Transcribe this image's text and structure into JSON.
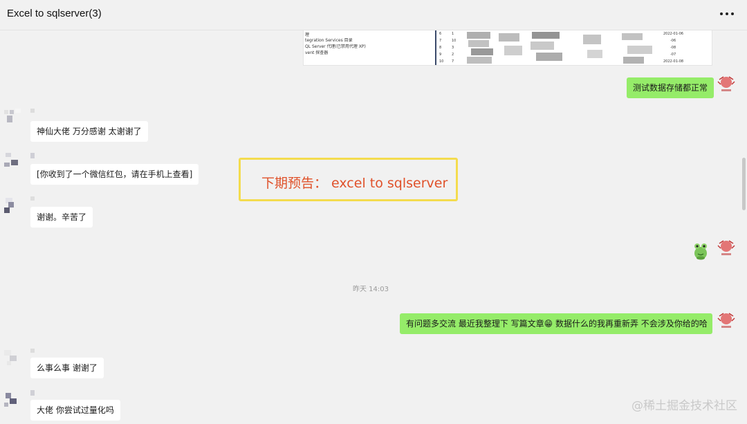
{
  "window": {
    "title": "Excel to sqlserver(3)",
    "more_icon": "more-horizontal-icon"
  },
  "embedded_screenshot": {
    "tree_items": [
      "理",
      "tegration Services 目录",
      "QL Server 代理(已禁用代理 XP)",
      "vent 探查器"
    ],
    "row_numbers": [
      "6",
      "7",
      "8",
      "9",
      "10"
    ],
    "row_values": [
      "1",
      "10",
      "3",
      "2",
      "7"
    ],
    "date_fragments": [
      "2022-01-06",
      "-06",
      "-08",
      "-07",
      "2022-01-08"
    ]
  },
  "messages": [
    {
      "side": "me",
      "text": "测试数据存储都正常"
    },
    {
      "side": "them",
      "text": "神仙大佬 万分感谢 太谢谢了"
    },
    {
      "side": "them",
      "text": "[你收到了一个微信红包，请在手机上查看]"
    },
    {
      "side": "them",
      "text": "谢谢。辛苦了"
    },
    {
      "side": "me",
      "sticker": "frog-sticker-icon"
    },
    {
      "side": "me",
      "text": "有问题多交流 最近我整理下 写篇文章😁 数据什么的我再重新弄 不会涉及你给的哈"
    },
    {
      "side": "them",
      "text": "么事么事 谢谢了"
    },
    {
      "side": "them",
      "text": "大佬 你尝试过量化吗"
    }
  ],
  "timestamp": "昨天 14:03",
  "announcement": "下期预告：  excel to sqlserver",
  "watermark": "@稀土掘金技术社区",
  "colors": {
    "background": "#f1f1f1",
    "bubble_me": "#95ec69",
    "bubble_them": "#ffffff",
    "announce_border": "#f4dc4e",
    "announce_text": "#e0512a"
  }
}
